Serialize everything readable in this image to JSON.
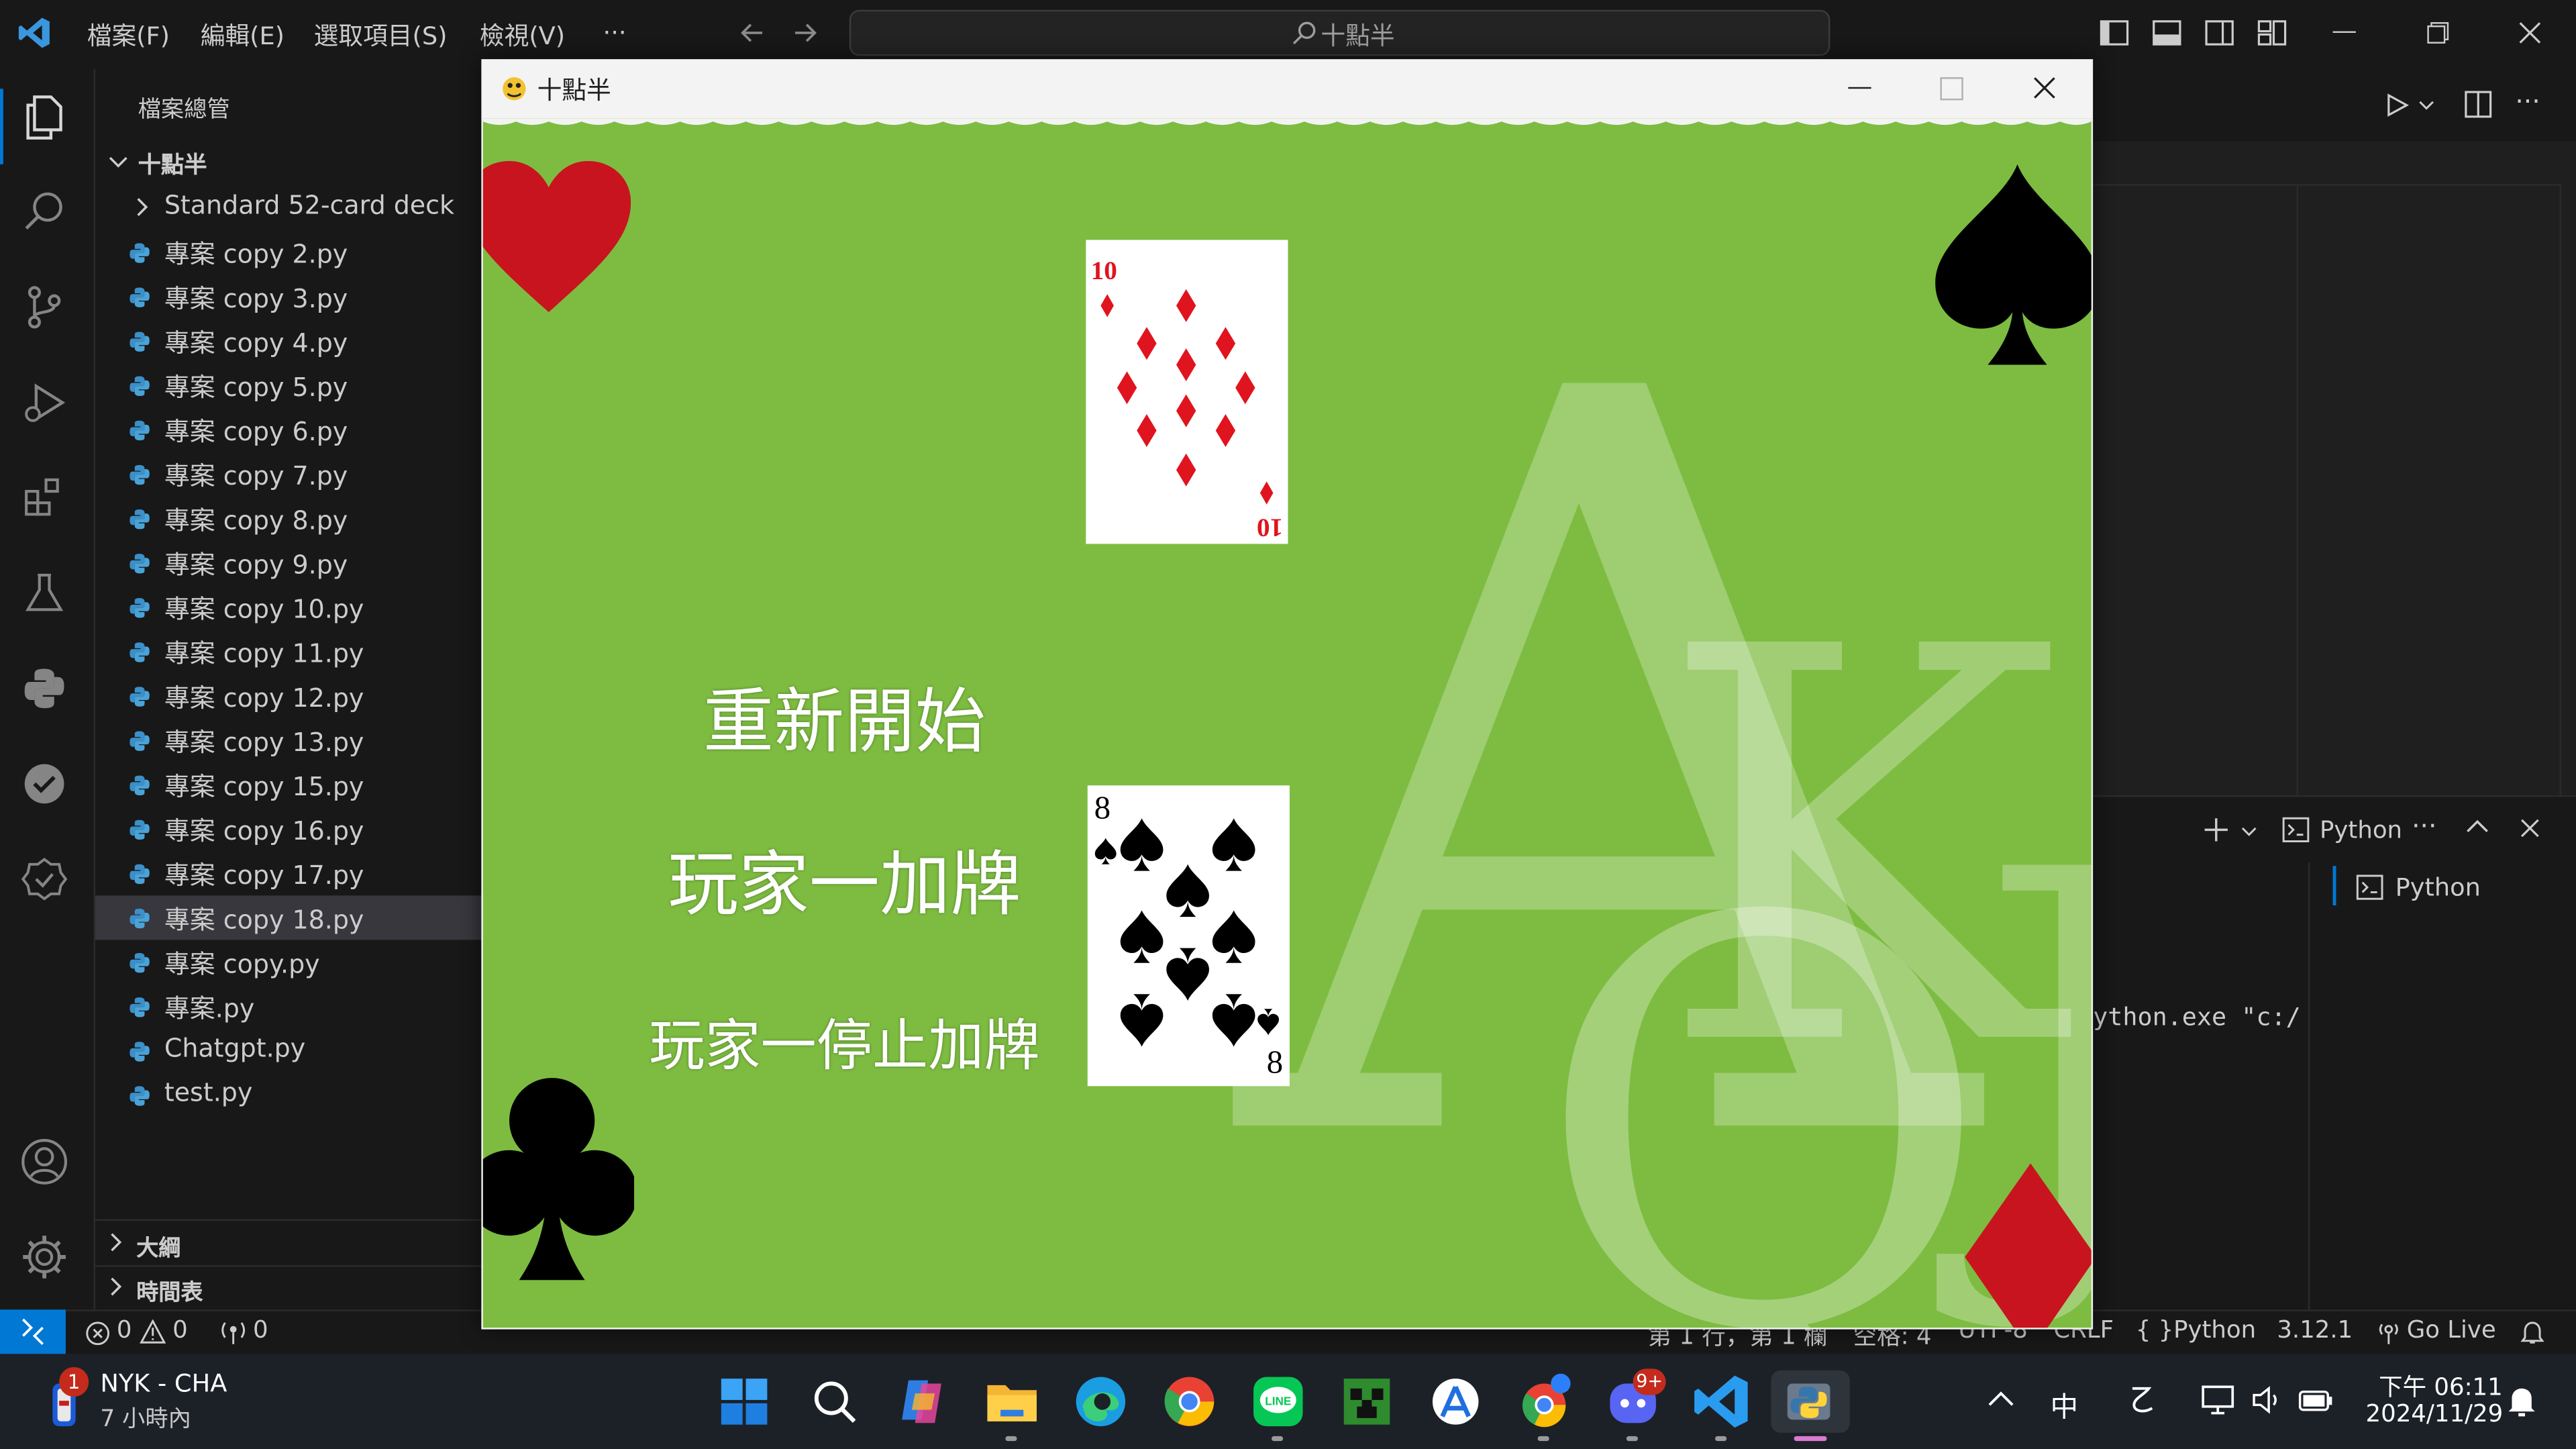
{
  "vscode": {
    "menu": [
      "檔案(F)",
      "編輯(E)",
      "選取項目(S)",
      "檢視(V)",
      "···"
    ],
    "command_center": "十點半",
    "sidebar": {
      "title": "檔案總管",
      "folder": "十點半",
      "items": [
        {
          "label": "Standard 52-card deck",
          "kind": "folder"
        },
        {
          "label": "專案 copy 2.py"
        },
        {
          "label": "專案 copy 3.py"
        },
        {
          "label": "專案 copy 4.py"
        },
        {
          "label": "專案 copy 5.py"
        },
        {
          "label": "專案 copy 6.py"
        },
        {
          "label": "專案 copy 7.py"
        },
        {
          "label": "專案 copy 8.py"
        },
        {
          "label": "專案 copy 9.py"
        },
        {
          "label": "專案 copy 10.py"
        },
        {
          "label": "專案 copy 11.py"
        },
        {
          "label": "專案 copy 12.py"
        },
        {
          "label": "專案 copy 13.py"
        },
        {
          "label": "專案 copy 15.py"
        },
        {
          "label": "專案 copy 16.py"
        },
        {
          "label": "專案 copy 17.py"
        },
        {
          "label": "專案 copy 18.py",
          "selected": true
        },
        {
          "label": "專案 copy.py"
        },
        {
          "label": "專案.py"
        },
        {
          "label": "Chatgpt.py"
        },
        {
          "label": "test.py"
        }
      ],
      "outline": "大綱",
      "timeline": "時間表"
    },
    "terminal": {
      "shell_label": "Python",
      "list_item": "Python",
      "command_fragment": "ython.exe \"c:/"
    },
    "statusbar": {
      "errors": "0",
      "warnings": "0",
      "ports": "0",
      "position": "第 1 行，第 1 欄",
      "spaces": "空格: 4",
      "encoding": "UTF-8",
      "eol": "CRLF",
      "language": "Python",
      "version": "3.12.1",
      "golive": "Go Live"
    }
  },
  "game": {
    "window_title": "十點半",
    "buttons": {
      "restart": "重新開始",
      "hit": "玩家一加牌",
      "stand": "玩家一停止加牌"
    },
    "cards": [
      {
        "rank": "10",
        "suit": "diamonds",
        "color": "#e0141e"
      },
      {
        "rank": "8",
        "suit": "spades",
        "color": "#000000"
      }
    ],
    "background_letters": [
      "A",
      "K",
      "Q",
      "J"
    ],
    "colors": {
      "felt": "#7dbc41",
      "heart": "#c8141e",
      "spade": "#000000"
    }
  },
  "taskbar": {
    "weather_badge": "1",
    "weather_title": "NYK - CHA",
    "weather_sub": "7 小時內",
    "ime": "中",
    "time": "下午 06:11",
    "date": "2024/11/29",
    "discord_badge": "9+"
  }
}
